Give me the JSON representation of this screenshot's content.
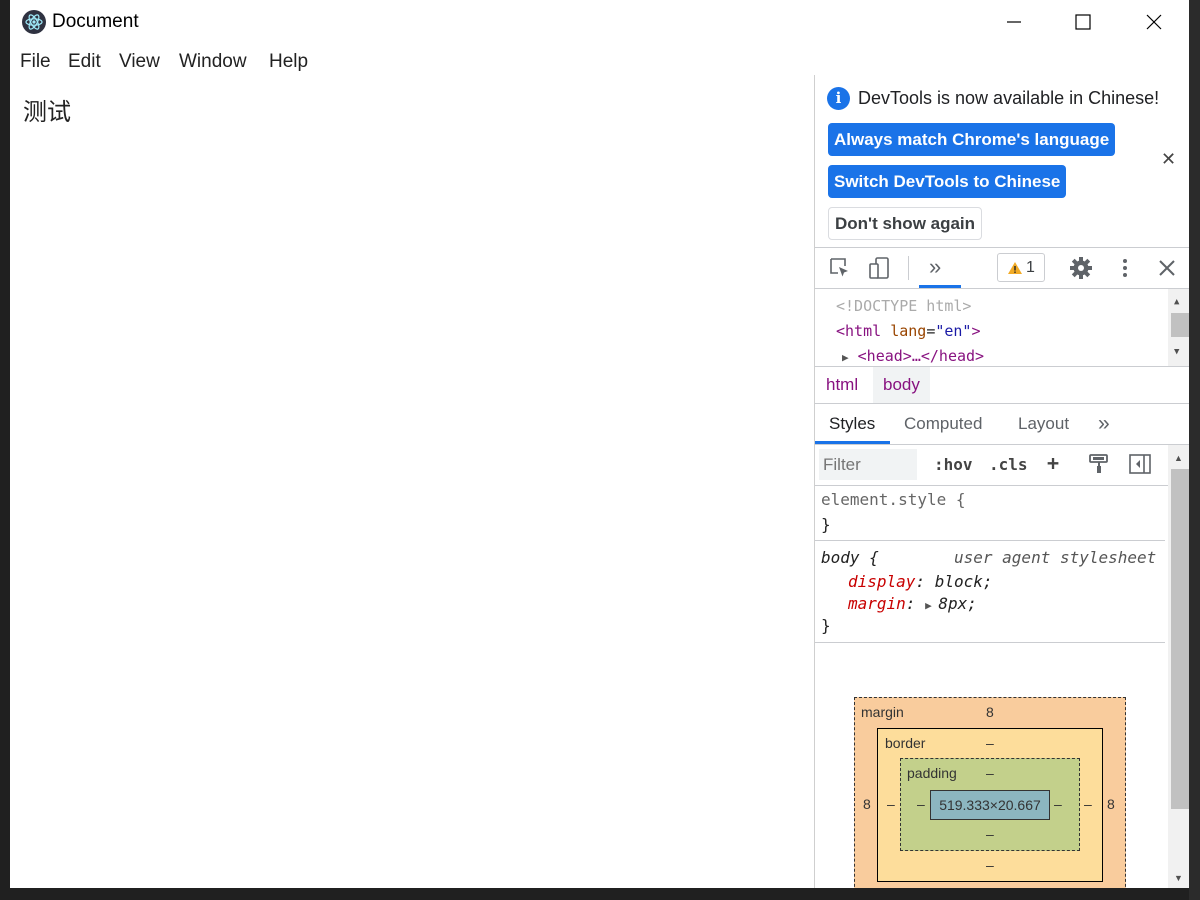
{
  "window": {
    "title": "Document"
  },
  "menu": {
    "items": [
      "File",
      "Edit",
      "View",
      "Window",
      "Help"
    ]
  },
  "page": {
    "text": "测试"
  },
  "devtools": {
    "infobar": {
      "message": "DevTools is now available in Chinese!",
      "buttons": [
        "Always match Chrome's language",
        "Switch DevTools to Chinese",
        "Don't show again"
      ]
    },
    "toolbar": {
      "warnings_count": "1",
      "more_tabs": "»"
    },
    "elements": {
      "doctype": "<!DOCTYPE html>",
      "html_open_tag": "html",
      "html_attr": "lang",
      "html_attr_value": "\"en\"",
      "head_collapsed": "<head>…</head>"
    },
    "breadcrumbs": [
      "html",
      "body"
    ],
    "tabs": [
      "Styles",
      "Computed",
      "Layout",
      "»"
    ],
    "filter": {
      "placeholder": "Filter",
      "hov": ":hov",
      "cls": ".cls",
      "add": "+"
    },
    "styles": {
      "element_style_selector": "element.style {",
      "close_brace": "}",
      "body_selector": "body {",
      "body_source": "user agent stylesheet",
      "props": [
        {
          "name": "display",
          "value": "block;"
        },
        {
          "name": "margin",
          "value": "8px;"
        }
      ]
    },
    "box_model": {
      "margin_label": "margin",
      "margin_top": "8",
      "margin_left": "8",
      "margin_right": "8",
      "border_label": "border",
      "border_top": "–",
      "border_bottom": "–",
      "border_left": "–",
      "border_right": "–",
      "padding_label": "padding",
      "padding_top": "–",
      "padding_bottom": "–",
      "padding_left": "–",
      "padding_right": "–",
      "content_size": "519.333×20.667"
    }
  },
  "colors": {
    "accent": "#1a73e8",
    "margin": "#f9cc9d",
    "border": "#fddd9b",
    "padding": "#c3d08b",
    "content": "#8cb6c0"
  }
}
